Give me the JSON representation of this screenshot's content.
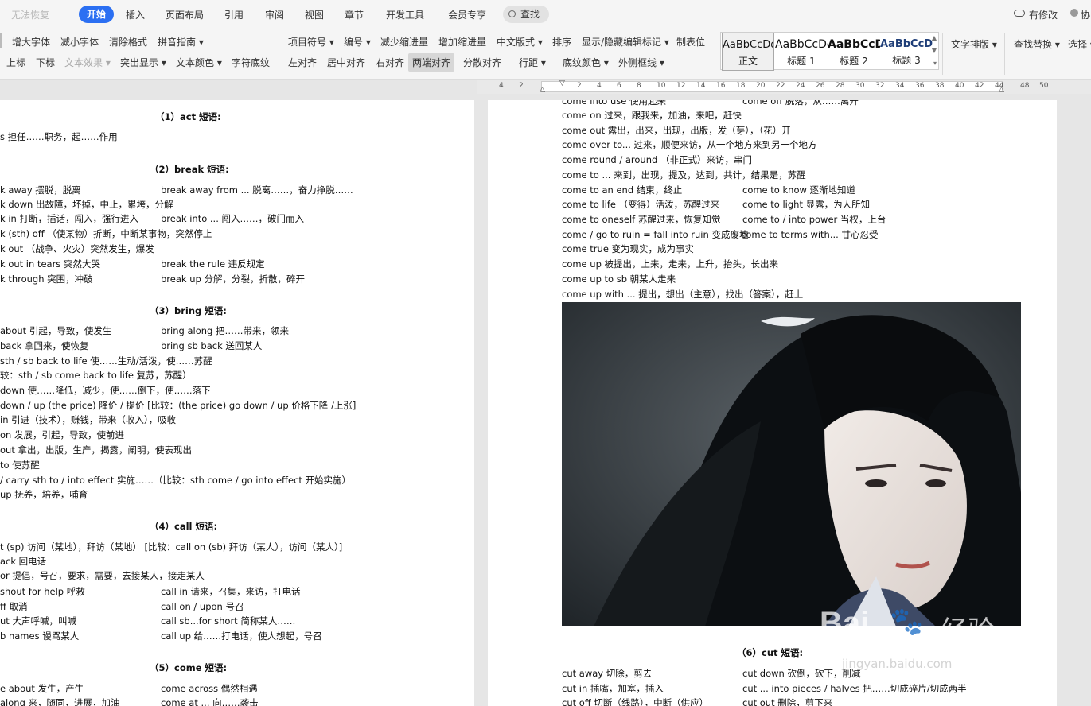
{
  "menubar": {
    "undo": "无法恢复",
    "tabs": [
      "开始",
      "插入",
      "页面布局",
      "引用",
      "审阅",
      "视图",
      "章节",
      "开发工具",
      "会员专享"
    ],
    "search": "查找",
    "modify": "有修改",
    "collab": "协"
  },
  "ribbon": {
    "font_row1": [
      "增大字体",
      "减小字体",
      "清除格式",
      "拼音指南"
    ],
    "font_row2": [
      "上标",
      "下标",
      "文本效果",
      "突出显示",
      "文本颜色",
      "字符底纹"
    ],
    "para_row1": [
      "项目符号",
      "编号",
      "减少缩进量",
      "增加缩进量",
      "中文版式",
      "排序",
      "显示/隐藏编辑标记",
      "制表位"
    ],
    "para_row2": [
      "左对齐",
      "居中对齐",
      "右对齐",
      "两端对齐",
      "分散对齐",
      "行距",
      "底纹颜色",
      "外侧框线"
    ],
    "styles": [
      {
        "preview": "AaBbCcDd",
        "name": "正文"
      },
      {
        "preview": "AaBbCcDc",
        "name": "标题 1"
      },
      {
        "preview": "AaBbCcD",
        "name": "标题 2"
      },
      {
        "preview": "AaBbCcDd",
        "name": "标题 3"
      }
    ],
    "text_layout": "文字排版",
    "find_replace": "查找替换",
    "select": "选择"
  },
  "ruler": [
    "4",
    "2",
    "2",
    "4",
    "6",
    "8",
    "10",
    "12",
    "14",
    "16",
    "18",
    "20",
    "22",
    "24",
    "26",
    "28",
    "30",
    "32",
    "34",
    "36",
    "38",
    "40",
    "42",
    "44",
    "48",
    "50"
  ],
  "left_page": {
    "h1": "（1）act 短语:",
    "l1": "s  担任……职务，起……作用",
    "h2": "（2）break 短语:",
    "b1a": "k away  摆脱，脱离",
    "b1b": "break away from ...  脱离……，奋力挣脱……",
    "b2": "k down  出故障，坏掉，中止，累垮，分解",
    "b3a": "k in  打断，插话，闯入，强行进入",
    "b3b": "break into ...  闯入……，破门而入",
    "b4": "k (sth) off （使某物）折断，中断某事物，突然停止",
    "b5": "k out （战争、火灾）突然发生，爆发",
    "b6a": "k out in tears  突然大哭",
    "b6b": "break the rule  违反规定",
    "b7a": "k through  突围，冲破",
    "b7b": "break up  分解，分裂，折散，碎开",
    "h3": "（3）bring 短语:",
    "c1a": "about  引起，导致，使发生",
    "c1b": "bring along  把……带来，领来",
    "c2a": "back  拿回来，使恢复",
    "c2b": "bring sb back  送回某人",
    "c3": "sth / sb back to life  使……生动/活泼，使……苏醒",
    "c4": "较：sth / sb come back to life  复苏，苏醒）",
    "c5": "down  使……降低，减少，使……倒下，使……落下",
    "c6": "down / up (the price)  降价 / 提价  [比较：(the price) go down / up  价格下降 /上涨]",
    "c7": "in  引进（技术），赚钱，带来（收入），吸收",
    "c8": "on  发展，引起，导致，使前进",
    "c9": "out  拿出，出版，生产，揭露，阐明，使表现出",
    "c10": "to  使苏醒",
    "c11": "/ carry sth to / into effect  实施……（比较：sth come / go into effect  开始实施）",
    "c12": "up  抚养，培养，哺育",
    "h4": "（4）call 短语:",
    "d1": "t (sp)  访问（某地），拜访（某地）   [比较：call on (sb)  拜访（某人），访问（某人）]",
    "d2": "ack  回电话",
    "d3": "or  提倡，号召，要求，需要，去接某人，接走某人",
    "d4a": "shout for help  呼救",
    "d4b": "call in  请来，召集，来访，打电话",
    "d5a": "ff  取消",
    "d5b": "call on / upon  号召",
    "d6a": "ut  大声呼喊，叫喊",
    "d6b": "call sb...for short  简称某人……",
    "d7a": "b names  谩骂某人",
    "d7b": "call up  给……打电话，使人想起，号召",
    "h5": "（5）come 短语:",
    "e1a": "e about  发生，产生",
    "e1b": "come across  偶然相遇",
    "e2a": "along  来，随同，进展，加油",
    "e2b": "come at ...  向……袭击"
  },
  "right_page": {
    "r0a": "come into use  使用起来",
    "r0b": "come off  脱落，从……离开",
    "r1": "come on  过来，跟我来，加油，来吧，赶快",
    "r2": "come out  露出，出来，出现，出版，发（芽），（花）开",
    "r3": "come over to...  过来，顺便来访，从一个地方来到另一个地方",
    "r4": "come round / around  （非正式）来访，串门",
    "r5": "come to ...  来到，出现，提及，达到，共计，结果是，苏醒",
    "r6a": "come to an end  结束，终止",
    "r6b": "come to know  逐渐地知道",
    "r7a": "come to life  （变得）活泼，苏醒过来",
    "r7b": "come to light  显露，为人所知",
    "r8a": "come to oneself  苏醒过来，恢复知觉",
    "r8b": "come to / into power  当权，上台",
    "r9a": "come / go to ruin = fall into ruin  变成废墟",
    "r9b": "come to terms with...  甘心忍受",
    "r10": "come true  变为现实，成为事实",
    "r11": "come up  被提出，上来，走来，上升，抬头，长出来",
    "r12": "come up to sb  朝某人走来",
    "r13": "come up with ...  提出，想出（主意），找出（答案），赶上",
    "h6": "（6）cut 短语:",
    "s1a": "cut away  切除，剪去",
    "s1b": "cut down  砍倒，砍下，削减",
    "s2a": "cut in  插嘴，加塞，插入",
    "s2b": "cut ... into pieces / halves  把……切成碎片/切成两半",
    "s3a": "cut off  切断（线路），中断（供应）",
    "s3b": "cut out  删除，剪下来"
  },
  "watermark": {
    "brand": "Bai",
    "paw": "🐾",
    "suffix": "经验",
    "url": "jingyan.baidu.com"
  },
  "colors": {
    "accent": "#2b6ff2",
    "page_bg": "#e6e6e6"
  }
}
